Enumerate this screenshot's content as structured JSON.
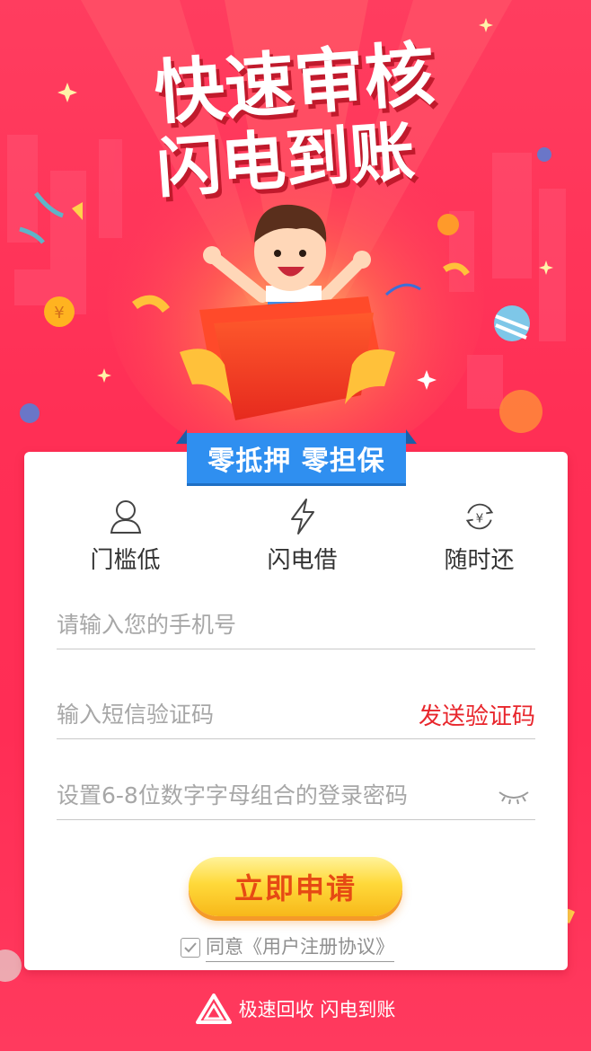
{
  "hero": {
    "headline_line1": "快速审核",
    "headline_line2": "闪电到账"
  },
  "badge": {
    "text": "零抵押 零担保"
  },
  "features": [
    {
      "icon": "person-icon",
      "label": "门槛低"
    },
    {
      "icon": "lightning-icon",
      "label": "闪电借"
    },
    {
      "icon": "yen-refresh-icon",
      "label": "随时还"
    }
  ],
  "form": {
    "phone_placeholder": "请输入您的手机号",
    "code_placeholder": "输入短信验证码",
    "send_code_label": "发送验证码",
    "password_placeholder": "设置6-8位数字字母组合的登录密码",
    "apply_label": "立即申请",
    "agree_text": "同意《用户注册协议》",
    "agree_checked": true
  },
  "footer": {
    "slogan": "极速回收 闪电到账"
  },
  "colors": {
    "background": "#ff2f55",
    "badge": "#2f8ff0",
    "send_code": "#e8262c",
    "apply_text": "#e64a14",
    "apply_button": "#ffd93a"
  }
}
